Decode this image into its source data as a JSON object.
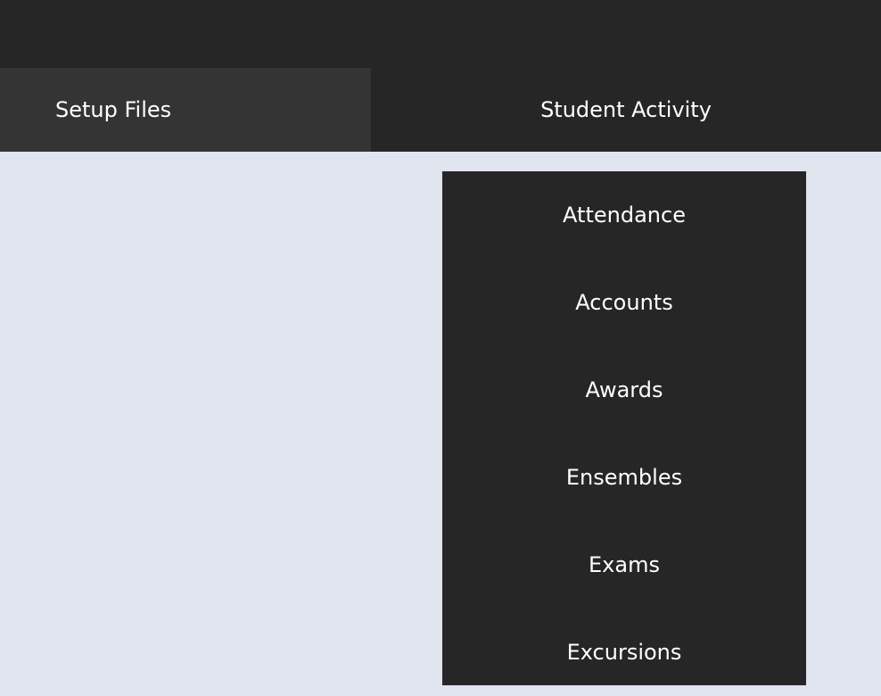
{
  "nav": {
    "tabs": [
      {
        "label": "Setup Files"
      },
      {
        "label": "Student Activity"
      }
    ]
  },
  "student_activity_menu": {
    "items": [
      {
        "label": "Attendance"
      },
      {
        "label": "Accounts"
      },
      {
        "label": "Awards"
      },
      {
        "label": "Ensembles"
      },
      {
        "label": "Exams"
      },
      {
        "label": "Excursions"
      }
    ]
  },
  "colors": {
    "page_background": "#dfe4ee",
    "bar_background": "#262626",
    "active_tab_background": "#343434",
    "text": "#ffffff"
  }
}
